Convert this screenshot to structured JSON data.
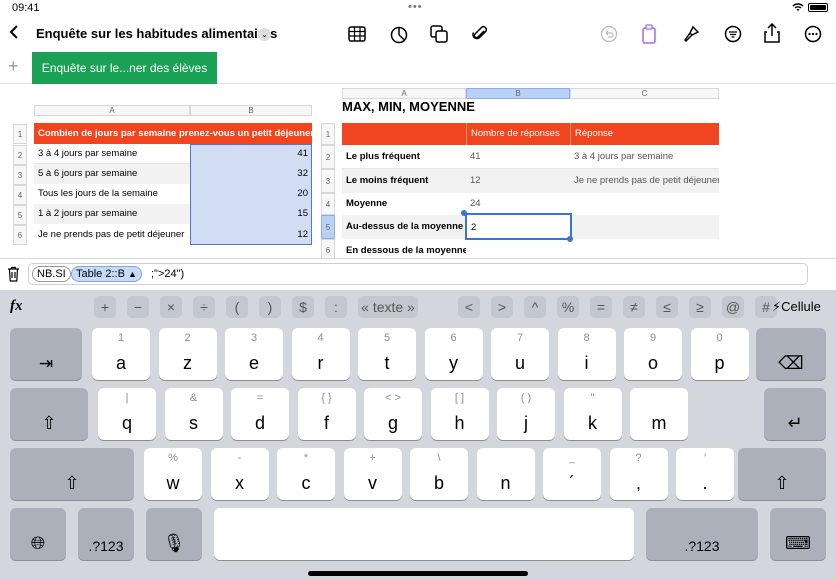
{
  "status": {
    "time": "09:41",
    "battery": "100%"
  },
  "toolbar": {
    "title": "Enquête sur les habitudes alimentaires"
  },
  "sheet_tab": {
    "label": "Enquête sur le...ner des élèves",
    "add": "+"
  },
  "table1": {
    "col_a": "A",
    "col_b": "B",
    "header": "Combien de jours par semaine prenez-vous un petit déjeuner ?",
    "rows": [
      {
        "num": "1"
      },
      {
        "num": "2",
        "a": "3 à 4 jours par semaine",
        "b": "41"
      },
      {
        "num": "3",
        "a": "5 à 6 jours par semaine",
        "b": "32"
      },
      {
        "num": "4",
        "a": "Tous les jours de la semaine",
        "b": "20"
      },
      {
        "num": "5",
        "a": "1 à 2 jours par semaine",
        "b": "15"
      },
      {
        "num": "6",
        "a": "Je ne prends pas de petit déjeuner",
        "b": "12"
      }
    ]
  },
  "table2": {
    "title": "MAX, MIN, MOYENNE",
    "col_a": "A",
    "col_b": "B",
    "col_c": "C",
    "header_b": "Nombre de réponses",
    "header_c": "Réponse",
    "rows": [
      {
        "num": "1"
      },
      {
        "num": "2",
        "a": "Le plus fréquent",
        "b": "41",
        "c": "3 à 4 jours par semaine"
      },
      {
        "num": "3",
        "a": "Le moins fréquent",
        "b": "12",
        "c": "Je ne prends pas de petit déjeuner"
      },
      {
        "num": "4",
        "a": "Moyenne",
        "b": "24",
        "c": ""
      },
      {
        "num": "5",
        "a": "Au-dessus de la moyenne",
        "b": "2",
        "c": ""
      },
      {
        "num": "6",
        "a": "En dessous de la moyenne",
        "b": "",
        "c": ""
      }
    ]
  },
  "formula": {
    "func": "NB.SI",
    "ref": "Table 2::B",
    "rest": ";\">24\")"
  },
  "keyboard": {
    "fx": "fx",
    "symbols": [
      "+",
      "−",
      "×",
      "÷",
      "(",
      ")",
      "$",
      ":",
      "« texte »",
      "<",
      ">",
      "^",
      "%",
      "=",
      "≠",
      "≤",
      "≥",
      "@",
      "#"
    ],
    "cell_mode": "Cellule",
    "row1": [
      {
        "t": "1",
        "m": "a"
      },
      {
        "t": "2",
        "m": "z"
      },
      {
        "t": "3",
        "m": "e"
      },
      {
        "t": "4",
        "m": "r"
      },
      {
        "t": "5",
        "m": "t"
      },
      {
        "t": "6",
        "m": "y"
      },
      {
        "t": "7",
        "m": "u"
      },
      {
        "t": "8",
        "m": "i"
      },
      {
        "t": "9",
        "m": "o"
      },
      {
        "t": "0",
        "m": "p"
      }
    ],
    "row2": [
      {
        "t": "|",
        "m": "q"
      },
      {
        "t": "&",
        "m": "s"
      },
      {
        "t": "=",
        "m": "d"
      },
      {
        "t": "{ }",
        "m": "f"
      },
      {
        "t": "< >",
        "m": "g"
      },
      {
        "t": "[ ]",
        "m": "h"
      },
      {
        "t": "( )",
        "m": "j"
      },
      {
        "t": "\"",
        "m": "k"
      },
      {
        "t": "",
        "m": "m"
      }
    ],
    "row3": [
      {
        "t": "%",
        "m": "w"
      },
      {
        "t": "-",
        "m": "x"
      },
      {
        "t": "*",
        "m": "c"
      },
      {
        "t": "+",
        "m": "v"
      },
      {
        "t": "\\",
        "m": "b"
      },
      {
        "t": "",
        "m": "n"
      },
      {
        "t": "_",
        "m": "´"
      },
      {
        "t": "?",
        "m": ","
      },
      {
        "t": "′",
        "m": "."
      }
    ],
    "num_label": ".?123"
  }
}
